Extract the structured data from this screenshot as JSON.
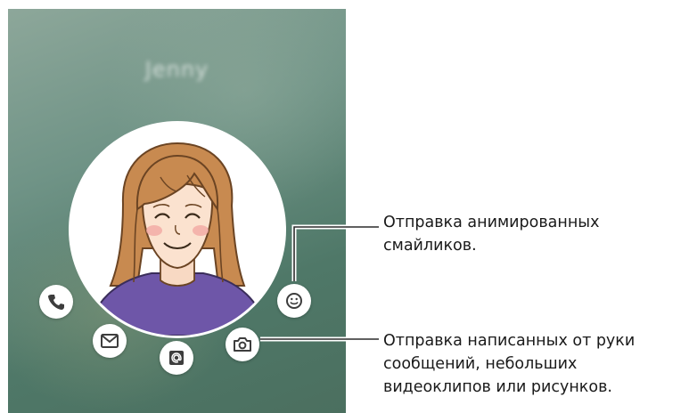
{
  "screen": {
    "contact_name": "Jenny"
  },
  "actions": [
    {
      "name": "phone-button",
      "icon": "phone-icon"
    },
    {
      "name": "message-button",
      "icon": "envelope-icon"
    },
    {
      "name": "email-button",
      "icon": "at-sign-icon"
    },
    {
      "name": "camera-button",
      "icon": "camera-icon"
    },
    {
      "name": "emoji-button",
      "icon": "smiley-icon"
    }
  ],
  "callouts": {
    "emoji": {
      "line1": "Отправка анимированных",
      "line2": "смайликов."
    },
    "camera": {
      "line1": "Отправка написанных от руки",
      "line2": "сообщений, небольших",
      "line3": "видеоклипов или рисунков."
    }
  },
  "colors": {
    "background_green": "#5f8576",
    "shirt_purple": "#6e56a8",
    "hair_brown": "#c88a50",
    "icon_dark": "#3d3d3d",
    "callout_line": "#2b2b2b"
  }
}
